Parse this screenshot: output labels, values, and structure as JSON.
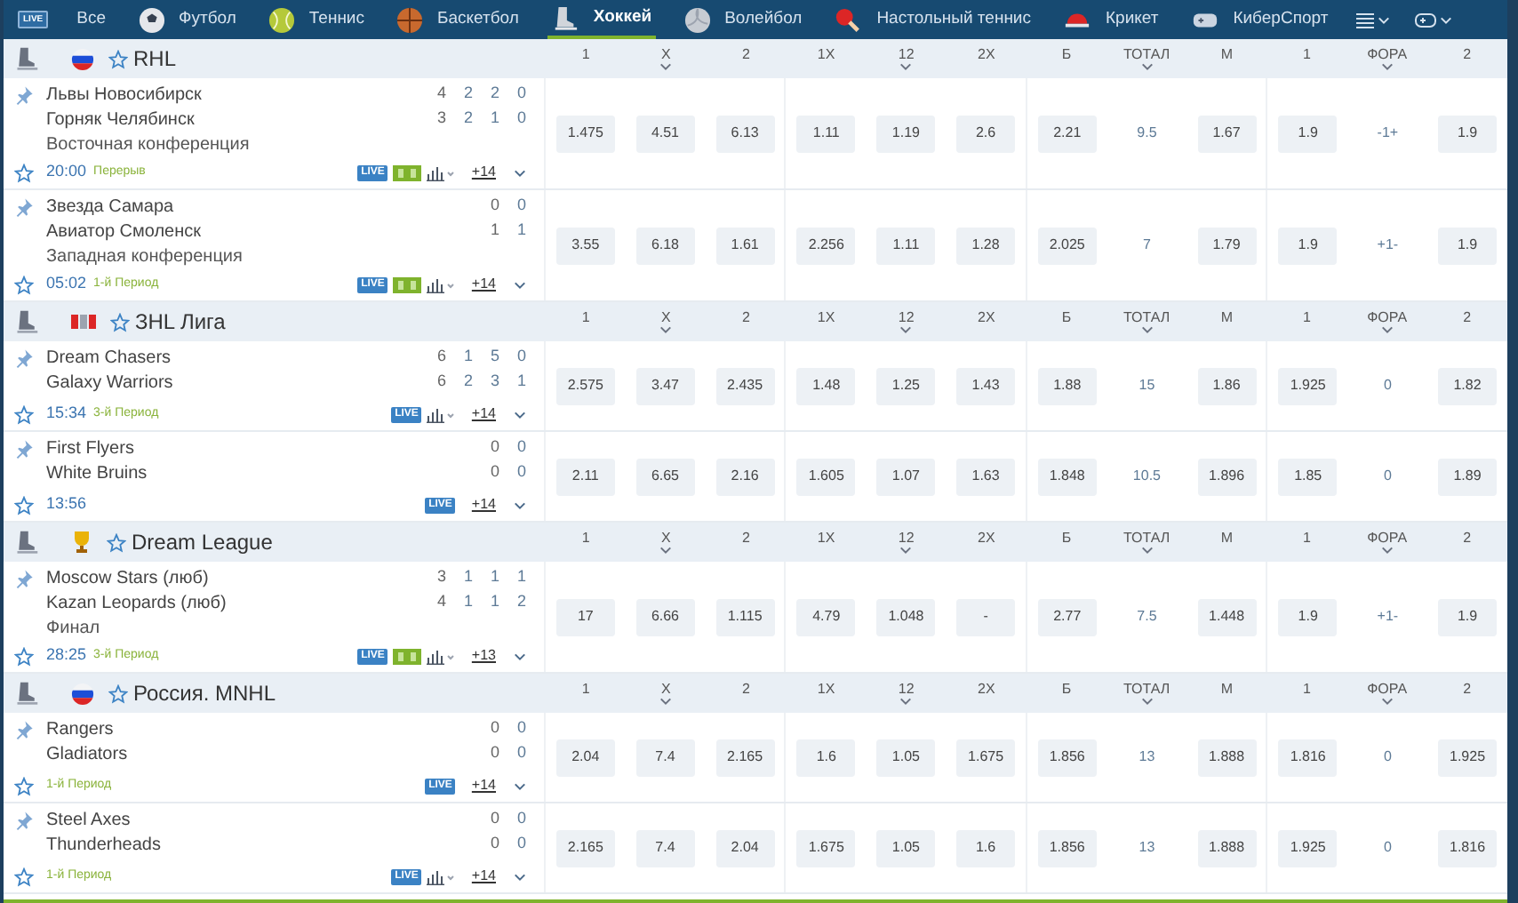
{
  "nav": {
    "live_badge": "LIVE",
    "items": [
      {
        "kind": "all",
        "label": "Все",
        "selected": false
      },
      {
        "kind": "football",
        "label": "Футбол",
        "selected": false
      },
      {
        "kind": "tennis",
        "label": "Теннис",
        "selected": false
      },
      {
        "kind": "basketball",
        "label": "Баскетбол",
        "selected": false
      },
      {
        "kind": "hockey",
        "label": "Хоккей",
        "selected": true
      },
      {
        "kind": "volleyball",
        "label": "Волейбол",
        "selected": false
      },
      {
        "kind": "tabletennis",
        "label": "Настольный теннис",
        "selected": false
      },
      {
        "kind": "cricket",
        "label": "Крикет",
        "selected": false
      },
      {
        "kind": "esports",
        "label": "КиберСпорт",
        "selected": false
      }
    ]
  },
  "leagues": [
    {
      "name": "RHL",
      "kind": "russia",
      "columns": [
        {
          "label": "1",
          "dropdown": false,
          "kind": "odd"
        },
        {
          "label": "X",
          "dropdown": true,
          "kind": "odd"
        },
        {
          "label": "2",
          "dropdown": false,
          "kind": "odd"
        },
        {
          "label": "1X",
          "dropdown": false,
          "kind": "odd"
        },
        {
          "label": "12",
          "dropdown": true,
          "kind": "odd"
        },
        {
          "label": "2X",
          "dropdown": false,
          "kind": "odd"
        },
        {
          "label": "Б",
          "dropdown": false,
          "kind": "odd"
        },
        {
          "label": "ТОТАЛ",
          "dropdown": true,
          "kind": "param"
        },
        {
          "label": "М",
          "dropdown": false,
          "kind": "odd"
        },
        {
          "label": "1",
          "dropdown": false,
          "kind": "odd"
        },
        {
          "label": "ФОРА",
          "dropdown": true,
          "kind": "param"
        },
        {
          "label": "2",
          "dropdown": false,
          "kind": "odd"
        }
      ],
      "matches": [
        {
          "teams": [
            {
              "name": "Львы Новосибирск",
              "scores": [
                "4",
                "2",
                "2",
                "0"
              ]
            },
            {
              "name": "Горняк Челябинск",
              "scores": [
                "3",
                "2",
                "1",
                "0"
              ]
            }
          ],
          "subtitle": "Восточная конференция",
          "time": "20:00",
          "period": "Перерыв",
          "live": "LIVE",
          "scoreboard": true,
          "stats": true,
          "more": "+14",
          "odds": [
            "1.475",
            "4.51",
            "6.13",
            "1.11",
            "1.19",
            "2.6",
            "2.21",
            "9.5",
            "1.67",
            "1.9",
            "-1+",
            "1.9"
          ]
        },
        {
          "teams": [
            {
              "name": "Звезда Самара",
              "scores": [
                "0",
                "0"
              ]
            },
            {
              "name": "Авиатор Смоленск",
              "scores": [
                "1",
                "1"
              ]
            }
          ],
          "subtitle": "Западная конференция",
          "time": "05:02",
          "period": "1-й Период",
          "live": "LIVE",
          "scoreboard": true,
          "stats": true,
          "more": "+14",
          "odds": [
            "3.55",
            "6.18",
            "1.61",
            "2.256",
            "1.11",
            "1.28",
            "2.025",
            "7",
            "1.79",
            "1.9",
            "+1-",
            "1.9"
          ]
        }
      ]
    },
    {
      "name": "ЗHL Лига",
      "kind": "logo",
      "columns": [
        {
          "label": "1",
          "dropdown": false,
          "kind": "odd"
        },
        {
          "label": "X",
          "dropdown": true,
          "kind": "odd"
        },
        {
          "label": "2",
          "dropdown": false,
          "kind": "odd"
        },
        {
          "label": "1X",
          "dropdown": false,
          "kind": "odd"
        },
        {
          "label": "12",
          "dropdown": true,
          "kind": "odd"
        },
        {
          "label": "2X",
          "dropdown": false,
          "kind": "odd"
        },
        {
          "label": "Б",
          "dropdown": false,
          "kind": "odd"
        },
        {
          "label": "ТОТАЛ",
          "dropdown": true,
          "kind": "param"
        },
        {
          "label": "М",
          "dropdown": false,
          "kind": "odd"
        },
        {
          "label": "1",
          "dropdown": false,
          "kind": "odd"
        },
        {
          "label": "ФОРА",
          "dropdown": true,
          "kind": "param"
        },
        {
          "label": "2",
          "dropdown": false,
          "kind": "odd"
        }
      ],
      "matches": [
        {
          "teams": [
            {
              "name": "Dream Chasers",
              "scores": [
                "6",
                "1",
                "5",
                "0"
              ]
            },
            {
              "name": "Galaxy Warriors",
              "scores": [
                "6",
                "2",
                "3",
                "1"
              ]
            }
          ],
          "time": "15:34",
          "period": "3-й Период",
          "live": "LIVE",
          "scoreboard": false,
          "stats": true,
          "more": "+14",
          "odds": [
            "2.575",
            "3.47",
            "2.435",
            "1.48",
            "1.25",
            "1.43",
            "1.88",
            "15",
            "1.86",
            "1.925",
            "0",
            "1.82"
          ]
        },
        {
          "teams": [
            {
              "name": "First Flyers",
              "scores": [
                "0",
                "0"
              ]
            },
            {
              "name": "White Bruins",
              "scores": [
                "0",
                "0"
              ]
            }
          ],
          "time": "13:56",
          "live": "LIVE",
          "scoreboard": false,
          "stats": false,
          "more": "+14",
          "odds": [
            "2.11",
            "6.65",
            "2.16",
            "1.605",
            "1.07",
            "1.63",
            "1.848",
            "10.5",
            "1.896",
            "1.85",
            "0",
            "1.89"
          ]
        }
      ]
    },
    {
      "name": "Dream League",
      "kind": "trophy",
      "columns": [
        {
          "label": "1",
          "dropdown": false,
          "kind": "odd"
        },
        {
          "label": "X",
          "dropdown": true,
          "kind": "odd"
        },
        {
          "label": "2",
          "dropdown": false,
          "kind": "odd"
        },
        {
          "label": "1X",
          "dropdown": false,
          "kind": "odd"
        },
        {
          "label": "12",
          "dropdown": true,
          "kind": "odd"
        },
        {
          "label": "2X",
          "dropdown": false,
          "kind": "odd"
        },
        {
          "label": "Б",
          "dropdown": false,
          "kind": "odd"
        },
        {
          "label": "ТОТАЛ",
          "dropdown": true,
          "kind": "param"
        },
        {
          "label": "М",
          "dropdown": false,
          "kind": "odd"
        },
        {
          "label": "1",
          "dropdown": false,
          "kind": "odd"
        },
        {
          "label": "ФОРА",
          "dropdown": true,
          "kind": "param"
        },
        {
          "label": "2",
          "dropdown": false,
          "kind": "odd"
        }
      ],
      "matches": [
        {
          "teams": [
            {
              "name": "Moscow Stars (люб)",
              "scores": [
                "3",
                "1",
                "1",
                "1"
              ]
            },
            {
              "name": "Kazan Leopards (люб)",
              "scores": [
                "4",
                "1",
                "1",
                "2"
              ]
            }
          ],
          "subtitle": "Финал",
          "time": "28:25",
          "period": "3-й Период",
          "live": "LIVE",
          "scoreboard": true,
          "stats": true,
          "more": "+13",
          "odds": [
            "17",
            "6.66",
            "1.115",
            "4.79",
            "1.048",
            "-",
            "2.77",
            "7.5",
            "1.448",
            "1.9",
            "+1-",
            "1.9"
          ]
        }
      ]
    },
    {
      "name": "Россия. MNHL",
      "kind": "russia",
      "columns": [
        {
          "label": "1",
          "dropdown": false,
          "kind": "odd"
        },
        {
          "label": "X",
          "dropdown": true,
          "kind": "odd"
        },
        {
          "label": "2",
          "dropdown": false,
          "kind": "odd"
        },
        {
          "label": "1X",
          "dropdown": false,
          "kind": "odd"
        },
        {
          "label": "12",
          "dropdown": true,
          "kind": "odd"
        },
        {
          "label": "2X",
          "dropdown": false,
          "kind": "odd"
        },
        {
          "label": "Б",
          "dropdown": false,
          "kind": "odd"
        },
        {
          "label": "ТОТАЛ",
          "dropdown": true,
          "kind": "param"
        },
        {
          "label": "М",
          "dropdown": false,
          "kind": "odd"
        },
        {
          "label": "1",
          "dropdown": false,
          "kind": "odd"
        },
        {
          "label": "ФОРА",
          "dropdown": true,
          "kind": "param"
        },
        {
          "label": "2",
          "dropdown": false,
          "kind": "odd"
        }
      ],
      "matches": [
        {
          "teams": [
            {
              "name": "Rangers",
              "scores": [
                "0",
                "0"
              ]
            },
            {
              "name": "Gladiators",
              "scores": [
                "0",
                "0"
              ]
            }
          ],
          "period": "1-й Период",
          "live": "LIVE",
          "scoreboard": false,
          "stats": false,
          "more": "+14",
          "odds": [
            "2.04",
            "7.4",
            "2.165",
            "1.6",
            "1.05",
            "1.675",
            "1.856",
            "13",
            "1.888",
            "1.816",
            "0",
            "1.925"
          ]
        },
        {
          "teams": [
            {
              "name": "Steel Axes",
              "scores": [
                "0",
                "0"
              ]
            },
            {
              "name": "Thunderheads",
              "scores": [
                "0",
                "0"
              ]
            }
          ],
          "period": "1-й Период",
          "live": "LIVE",
          "scoreboard": false,
          "stats": true,
          "more": "+14",
          "odds": [
            "2.165",
            "7.4",
            "2.04",
            "1.675",
            "1.05",
            "1.6",
            "1.856",
            "13",
            "1.888",
            "1.925",
            "0",
            "1.816"
          ]
        }
      ]
    }
  ]
}
